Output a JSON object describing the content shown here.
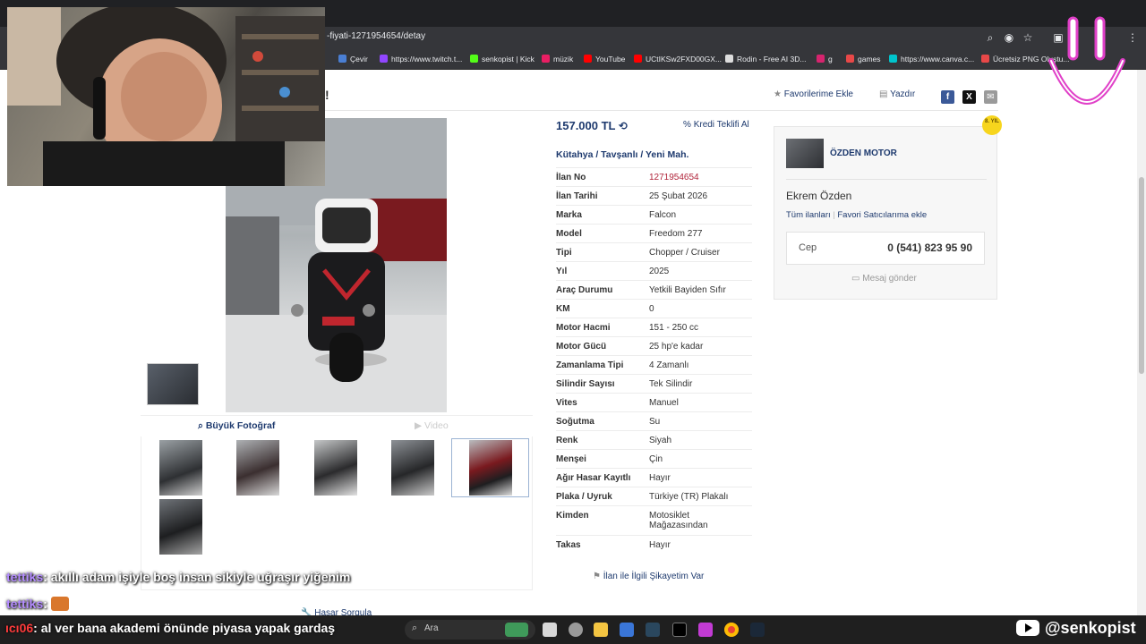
{
  "browser": {
    "url": "-fiyati-1271954654/detay",
    "bookmarks": [
      {
        "label": "Çevir",
        "color": "#4a7fd4"
      },
      {
        "label": "https://www.twitch.t...",
        "color": "#9146ff"
      },
      {
        "label": "senkopist | Kick",
        "color": "#53fc18"
      },
      {
        "label": "müzik",
        "color": "#e91e63"
      },
      {
        "label": "YouTube",
        "color": "#ff0000"
      },
      {
        "label": "UCtIKSw2FXD00GX...",
        "color": "#ff0000"
      },
      {
        "label": "Rodin - Free AI 3D...",
        "color": "#dddddd"
      },
      {
        "label": "g",
        "color": "#d6246e"
      },
      {
        "label": "games",
        "color": "#e84848"
      },
      {
        "label": "https://www.canva.c...",
        "color": "#00c4cc"
      },
      {
        "label": "Ücretsiz PNG Oluştu...",
        "color": "#e84848"
      }
    ]
  },
  "header": {
    "title_fragment": "!",
    "favorites": "Favorilerime Ekle",
    "print": "Yazdır"
  },
  "gallery": {
    "big_photo_tab": "Büyük Fotoğraf",
    "video_tab": "Video",
    "hasar": "Hasar Sorgula"
  },
  "listing": {
    "price": "157.000 TL",
    "credit": "Kredi Teklifi Al",
    "location": "Kütahya  /  Tavşanlı  /  Yeni Mah.",
    "specs": [
      {
        "k": "İlan No",
        "v": "1271954654",
        "highlight": true
      },
      {
        "k": "İlan Tarihi",
        "v": "25 Şubat 2026"
      },
      {
        "k": "Marka",
        "v": "Falcon"
      },
      {
        "k": "Model",
        "v": "Freedom 277"
      },
      {
        "k": "Tipi",
        "v": "Chopper / Cruiser"
      },
      {
        "k": "Yıl",
        "v": "2025"
      },
      {
        "k": "Araç Durumu",
        "v": "Yetkili Bayiden Sıfır"
      },
      {
        "k": "KM",
        "v": "0"
      },
      {
        "k": "Motor Hacmi",
        "v": "151 - 250 cc"
      },
      {
        "k": "Motor Gücü",
        "v": "25 hp'e kadar"
      },
      {
        "k": "Zamanlama Tipi",
        "v": "4 Zamanlı"
      },
      {
        "k": "Silindir Sayısı",
        "v": "Tek Silindir"
      },
      {
        "k": "Vites",
        "v": "Manuel"
      },
      {
        "k": "Soğutma",
        "v": "Su"
      },
      {
        "k": "Renk",
        "v": "Siyah"
      },
      {
        "k": "Menşei",
        "v": "Çin"
      },
      {
        "k": "Ağır Hasar Kayıtlı",
        "v": "Hayır"
      },
      {
        "k": "Plaka / Uyruk",
        "v": "Türkiye (TR) Plakalı"
      },
      {
        "k": "Kimden",
        "v": "Motosiklet Mağazasından",
        "tall": true
      },
      {
        "k": "Takas",
        "v": "Hayır"
      }
    ],
    "complaint": "İlan ile İlgili Şikayetim Var"
  },
  "seller": {
    "store": "ÖZDEN MOTOR",
    "name": "Ekrem Özden",
    "all_listings": "Tüm ilanları",
    "favorite": "Favori Satıcılarıma ekle",
    "phone_label": "Cep",
    "phone": "0 (541) 823 95 90",
    "message": "Mesaj gönder",
    "badge": "8. YIL"
  },
  "chat": [
    {
      "user": "tettiks",
      "msg": ": akıllı adam işiyle boş insan sikiyle uğraşır yiğenim"
    },
    {
      "user": "tettiks",
      "msg": ":"
    }
  ],
  "bottom_chat": {
    "user": "ıcı06",
    "msg": ": al ver bana akademi önünde piyasa yapak gardaş"
  },
  "taskbar": {
    "search": "Ara"
  },
  "stream": {
    "handle": "@senkopist"
  }
}
